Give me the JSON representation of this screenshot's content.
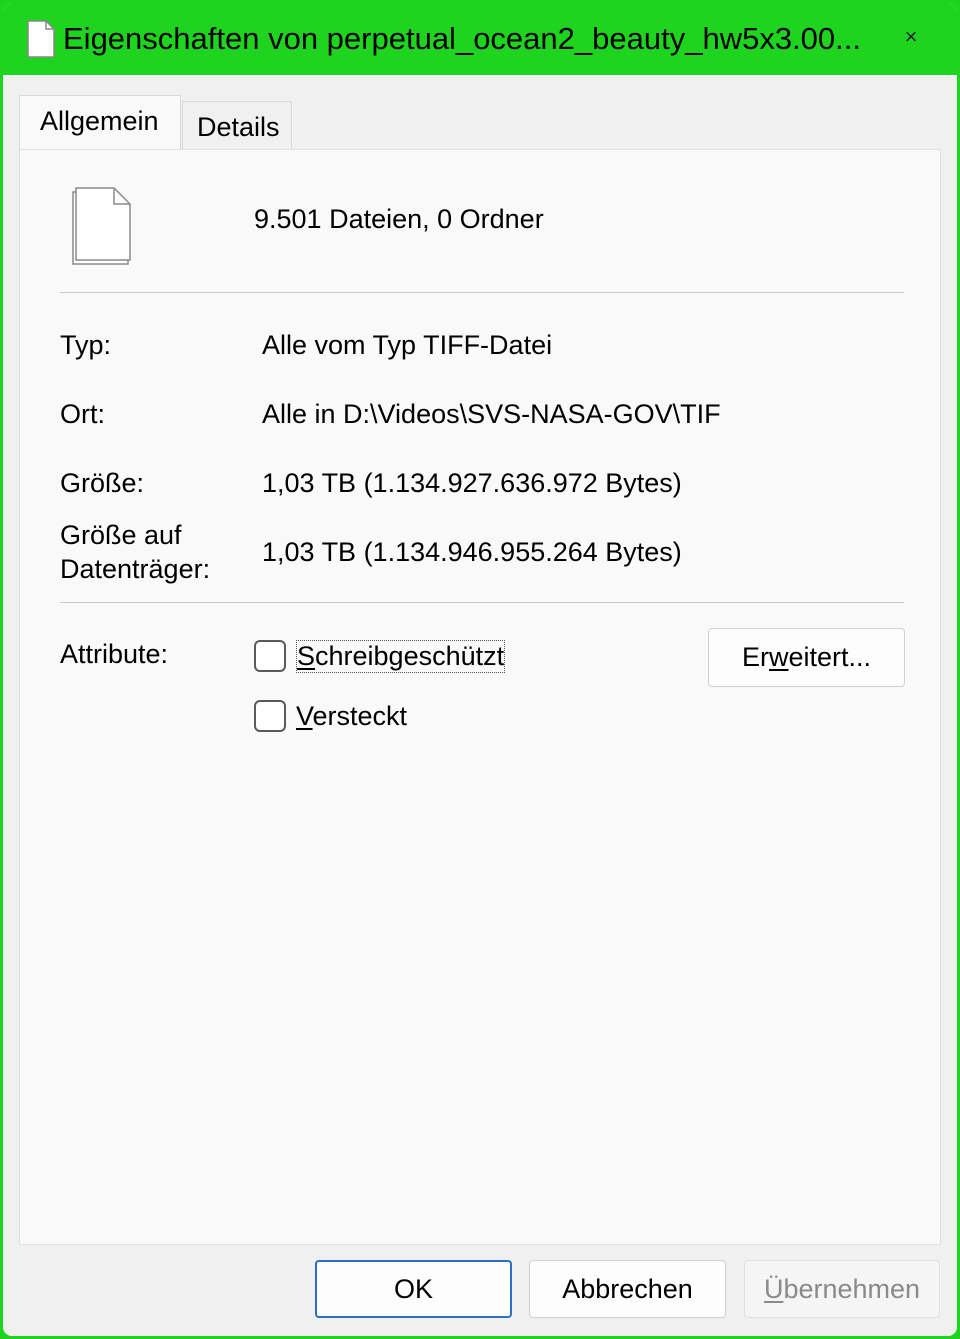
{
  "window": {
    "title": "Eigenschaften von perpetual_ocean2_beauty_hw5x3.00...",
    "close_glyph": "×",
    "accent_color": "#1fd41f"
  },
  "tabs": [
    {
      "label": "Allgemein",
      "active": true
    },
    {
      "label": "Details",
      "active": false
    }
  ],
  "general": {
    "summary": "9.501 Dateien, 0 Ordner",
    "rows": [
      {
        "label": "Typ:",
        "value": "Alle vom Typ TIFF-Datei"
      },
      {
        "label": "Ort:",
        "value": "Alle in D:\\Videos\\SVS-NASA-GOV\\TIF"
      },
      {
        "label": "Größe:",
        "value": "1,03 TB (1.134.927.636.972 Bytes)"
      },
      {
        "label_line1": "Größe auf",
        "label_line2": "Datenträger:",
        "value": "1,03 TB (1.134.946.955.264 Bytes)"
      }
    ],
    "attributes": {
      "label": "Attribute:",
      "readonly": {
        "accel": "S",
        "rest": "chreibgeschützt",
        "checked": false
      },
      "hidden": {
        "accel": "V",
        "rest": "ersteckt",
        "checked": false
      },
      "advanced_button": {
        "pre": "Er",
        "accel": "w",
        "post": "eitert..."
      }
    }
  },
  "footer": {
    "ok": "OK",
    "cancel": "Abbrechen",
    "apply_accel": "Ü",
    "apply_rest": "bernehmen"
  }
}
